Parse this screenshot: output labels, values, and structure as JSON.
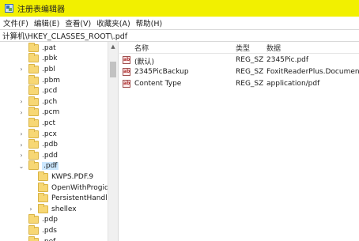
{
  "window": {
    "title": "注册表编辑器"
  },
  "menu": [
    "文件(F)",
    "编辑(E)",
    "查看(V)",
    "收藏夹(A)",
    "帮助(H)"
  ],
  "address": "计算机\\HKEY_CLASSES_ROOT\\.pdf",
  "tree": [
    {
      "label": ".pat",
      "expander": ""
    },
    {
      "label": ".pbk",
      "expander": ""
    },
    {
      "label": ".pbl",
      "expander": ">"
    },
    {
      "label": ".pbm",
      "expander": ""
    },
    {
      "label": ".pcd",
      "expander": ""
    },
    {
      "label": ".pch",
      "expander": ">"
    },
    {
      "label": ".pcm",
      "expander": ">"
    },
    {
      "label": ".pct",
      "expander": ""
    },
    {
      "label": ".pcx",
      "expander": ">"
    },
    {
      "label": ".pdb",
      "expander": ">"
    },
    {
      "label": ".pdd",
      "expander": ">"
    },
    {
      "label": ".pdf",
      "expander": "v",
      "selected": true
    },
    {
      "label": "KWPS.PDF.9",
      "expander": "",
      "child": true
    },
    {
      "label": "OpenWithProgids",
      "expander": "",
      "child": true
    },
    {
      "label": "PersistentHandler",
      "expander": "",
      "child": true
    },
    {
      "label": "shellex",
      "expander": ">",
      "child": true
    },
    {
      "label": ".pdp",
      "expander": ""
    },
    {
      "label": ".pds",
      "expander": ""
    },
    {
      "label": ".pef",
      "expander": ""
    }
  ],
  "list": {
    "headers": {
      "name": "名称",
      "type": "类型",
      "data": "数据"
    },
    "rows": [
      {
        "icon": "ab",
        "name": "(默认)",
        "type": "REG_SZ",
        "data": "2345Pic.pdf"
      },
      {
        "icon": "ab",
        "name": "2345PicBackup",
        "type": "REG_SZ",
        "data": "FoxitReaderPlus.Document"
      },
      {
        "icon": "ab",
        "name": "Content Type",
        "type": "REG_SZ",
        "data": "application/pdf"
      }
    ]
  }
}
